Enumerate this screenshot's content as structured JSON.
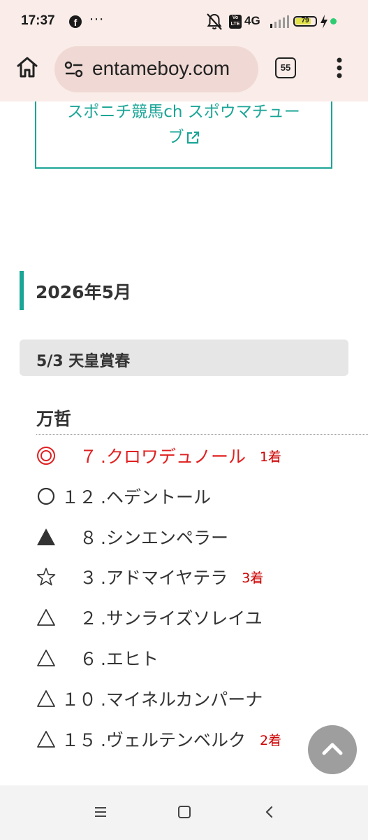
{
  "status_bar": {
    "time": "17:37",
    "notification_icon": "facebook-icon",
    "more": "···",
    "network": "4G",
    "volte": "Vo LTE",
    "battery": "79",
    "battery_level": 0.79,
    "battery_fill_color": "#e2e24a",
    "charging_indicator_color": "#2ecc71"
  },
  "browser": {
    "url": "entameboy.com",
    "tab_count": "55"
  },
  "page": {
    "link_label": "スポニチ競馬ch スポウマチューブ",
    "month_heading": "2026年5月",
    "race_title": "5/3 天皇賞春",
    "predictor": "万哲",
    "picks": [
      {
        "mark": "double-circle",
        "number": "７",
        "horse": ".クロワデュノール",
        "result": "1着",
        "highlight": true
      },
      {
        "mark": "circle",
        "number": "１２",
        "horse": ".ヘデントール",
        "result": "",
        "highlight": false
      },
      {
        "mark": "filled-triangle",
        "number": "８",
        "horse": ".シンエンペラー",
        "result": "",
        "highlight": false
      },
      {
        "mark": "star",
        "number": "３",
        "horse": ".アドマイヤテラ",
        "result": "3着",
        "highlight": false
      },
      {
        "mark": "triangle",
        "number": "２",
        "horse": ".サンライズソレイユ",
        "result": "",
        "highlight": false
      },
      {
        "mark": "triangle",
        "number": "６",
        "horse": ".エヒト",
        "result": "",
        "highlight": false
      },
      {
        "mark": "triangle",
        "number": "１０",
        "horse": ".マイネルカンパーナ",
        "result": "",
        "highlight": false
      },
      {
        "mark": "triangle",
        "number": "１５",
        "horse": ".ヴェルテンベルク",
        "result": "2着",
        "highlight": false
      }
    ]
  },
  "colors": {
    "accent": "#1aa596",
    "highlight_red": "#e02020",
    "result_red": "#cc0000",
    "chrome_background": "#faece8"
  }
}
